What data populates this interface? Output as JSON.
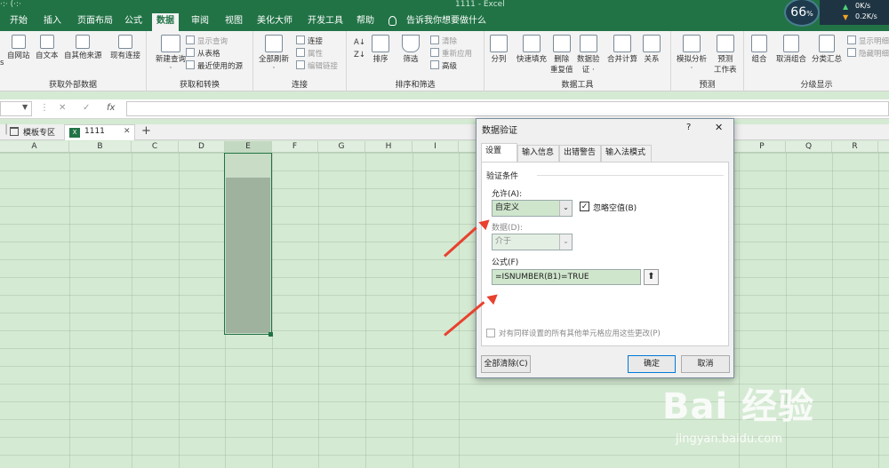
{
  "titlebar": {
    "left_text": "·:· (·:·",
    "doc_title": "1111 - Excel"
  },
  "menu": {
    "tabs": [
      "开始",
      "插入",
      "页面布局",
      "公式",
      "数据",
      "审阅",
      "视图",
      "美化大师",
      "开发工具",
      "帮助"
    ],
    "active": "数据",
    "tell_me": "告诉我你想要做什么"
  },
  "speed": {
    "percent": "66",
    "unit": "%",
    "up": "0K/s",
    "down": "0.2K/s"
  },
  "ribbon": {
    "get_external": {
      "items": [
        "自网站",
        "自文本",
        "自其他来源",
        "现有连接"
      ],
      "label": "获取外部数据",
      "cut_label": "s"
    },
    "transform": {
      "new_query": "新建查询",
      "new_query_sub": "·",
      "items": [
        "显示查询",
        "从表格",
        "最近使用的源"
      ],
      "label": "获取和转换"
    },
    "connections": {
      "refresh": "全部刷新",
      "refresh_sub": "·",
      "items": [
        "连接",
        "属性",
        "编辑链接"
      ],
      "label": "连接"
    },
    "sort_filter": {
      "sort": "排序",
      "filter": "筛选",
      "items": [
        "清除",
        "重新应用",
        "高级"
      ],
      "label": "排序和筛选"
    },
    "data_tools": {
      "items": [
        "分列",
        "快速填充",
        "删除重复值",
        "数据验证",
        "合并计算",
        "关系"
      ],
      "sub_items": [
        "重复值",
        "证 ·"
      ],
      "label": "数据工具"
    },
    "forecast": {
      "items": [
        "模拟分析",
        "预测工作表"
      ],
      "sub_items": [
        "·",
        "工作表"
      ],
      "label": "预测"
    },
    "outline": {
      "items": [
        "组合",
        "取消组合",
        "分类汇总"
      ],
      "side": [
        "显示明细",
        "隐藏明细"
      ],
      "label": "分级显示"
    }
  },
  "formula_bar": {
    "fx": "fx",
    "cancel": "✕",
    "confirm": "✓"
  },
  "sheet_tabs": {
    "template": "模板专区",
    "file": "1111",
    "add": "+"
  },
  "columns": [
    "A",
    "B",
    "C",
    "D",
    "E",
    "F",
    "G",
    "H",
    "I",
    "P",
    "Q",
    "R"
  ],
  "dialog": {
    "title": "数据验证",
    "help": "?",
    "close": "✕",
    "tabs": [
      "设置",
      "输入信息",
      "出错警告",
      "输入法模式"
    ],
    "active_tab": "设置",
    "section": "验证条件",
    "allow_label": "允许(A):",
    "allow_value": "自定义",
    "ignore_blank": "忽略空值(B)",
    "ignore_blank_checked": true,
    "data_label": "数据(D):",
    "data_value": "介于",
    "formula_label": "公式(F)",
    "formula_value": "=ISNUMBER(B1)=TRUE",
    "apply_all": "对有同样设置的所有其他单元格应用这些更改(P)",
    "clear_all": "全部清除(C)",
    "ok": "确定",
    "cancel": "取消"
  },
  "watermark": {
    "main": "Bai 经验",
    "sub": "jingyan.baidu.com"
  },
  "colors": {
    "accent": "#217346",
    "grid": "#d5ead3",
    "arrow": "#e8412e"
  }
}
